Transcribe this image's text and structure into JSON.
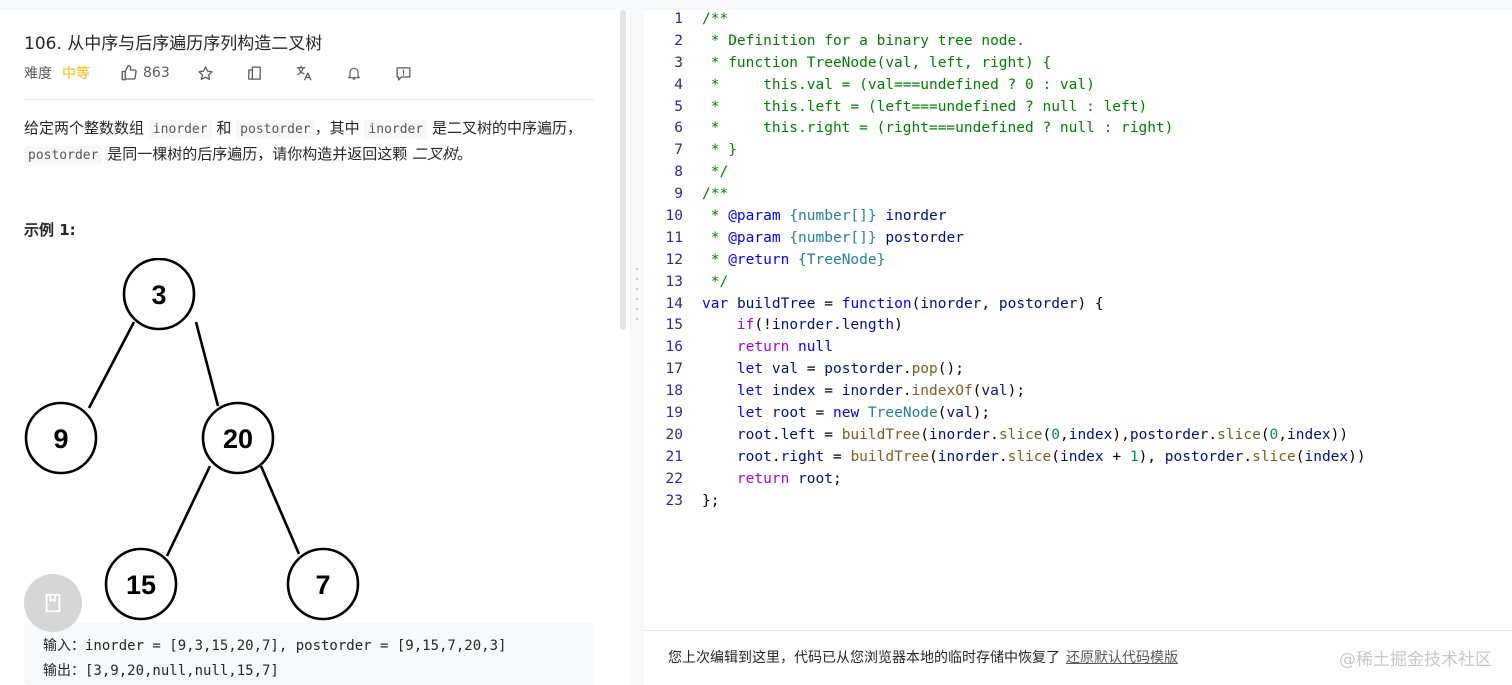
{
  "problem": {
    "title": "106. 从中序与后序遍历序列构造二叉树",
    "difficulty_label": "难度",
    "difficulty_value": "中等",
    "like_count": "863",
    "description": {
      "p1": "给定两个整数数组",
      "code1": "inorder",
      "p2": "和",
      "code2": "postorder",
      "p3": "，其中",
      "code3": "inorder",
      "p4": "是二叉树的中序遍历，",
      "code4": "postorder",
      "p5": "是同一棵树的后序遍历，请你构造并返回这颗",
      "p6": "二叉树",
      "p7": "。"
    },
    "example_title": "示例 1:",
    "tree_nodes": [
      "3",
      "9",
      "20",
      "15",
      "7"
    ],
    "example_input_label": "输入：",
    "example_input": "inorder = [9,3,15,20,7], postorder = [9,15,7,20,3]",
    "example_output_label": "输出：",
    "example_output": "[3,9,20,null,null,15,7]"
  },
  "icons": {
    "like": "thumbs-up-icon",
    "star": "star-icon",
    "share": "share-icon",
    "translate": "translate-icon",
    "notify": "bell-icon",
    "feedback": "feedback-icon",
    "note": "notebook-icon"
  },
  "colors": {
    "difficulty_medium": "#ffb800",
    "comment": "#008000",
    "keyword": "#0000ff",
    "control": "#af00db",
    "variable": "#001080",
    "function": "#795e26",
    "type": "#267f99",
    "number": "#098658",
    "line_number": "#2b2b8a"
  },
  "editor": {
    "lines": [
      {
        "n": "1",
        "tokens": [
          {
            "t": "/**",
            "c": "cm"
          }
        ]
      },
      {
        "n": "2",
        "tokens": [
          {
            "t": " * Definition for a binary tree node.",
            "c": "cm"
          }
        ]
      },
      {
        "n": "3",
        "tokens": [
          {
            "t": " * function TreeNode(val, left, right) {",
            "c": "cm"
          }
        ]
      },
      {
        "n": "4",
        "tokens": [
          {
            "t": " *     this.val = (val===undefined ? 0 : val)",
            "c": "cm"
          }
        ]
      },
      {
        "n": "5",
        "tokens": [
          {
            "t": " *     this.left = (left===undefined ? null : left)",
            "c": "cm"
          }
        ]
      },
      {
        "n": "6",
        "tokens": [
          {
            "t": " *     this.right = (right===undefined ? null : right)",
            "c": "cm"
          }
        ]
      },
      {
        "n": "7",
        "tokens": [
          {
            "t": " * }",
            "c": "cm"
          }
        ]
      },
      {
        "n": "8",
        "tokens": [
          {
            "t": " */",
            "c": "cm"
          }
        ]
      },
      {
        "n": "9",
        "tokens": [
          {
            "t": "/**",
            "c": "cm"
          }
        ]
      },
      {
        "n": "10",
        "tokens": [
          {
            "t": " * ",
            "c": "cm"
          },
          {
            "t": "@param",
            "c": "kw"
          },
          {
            "t": " ",
            "c": "cm"
          },
          {
            "t": "{number[]}",
            "c": "cls"
          },
          {
            "t": " ",
            "c": "cm"
          },
          {
            "t": "inorder",
            "c": "var"
          }
        ]
      },
      {
        "n": "11",
        "tokens": [
          {
            "t": " * ",
            "c": "cm"
          },
          {
            "t": "@param",
            "c": "kw"
          },
          {
            "t": " ",
            "c": "cm"
          },
          {
            "t": "{number[]}",
            "c": "cls"
          },
          {
            "t": " ",
            "c": "cm"
          },
          {
            "t": "postorder",
            "c": "var"
          }
        ]
      },
      {
        "n": "12",
        "tokens": [
          {
            "t": " * ",
            "c": "cm"
          },
          {
            "t": "@return",
            "c": "kw"
          },
          {
            "t": " ",
            "c": "cm"
          },
          {
            "t": "{TreeNode}",
            "c": "cls"
          }
        ]
      },
      {
        "n": "13",
        "tokens": [
          {
            "t": " */",
            "c": "cm"
          }
        ]
      },
      {
        "n": "14",
        "tokens": [
          {
            "t": "var",
            "c": "kw"
          },
          {
            "t": " ",
            "c": "pl"
          },
          {
            "t": "buildTree",
            "c": "var"
          },
          {
            "t": " = ",
            "c": "pl"
          },
          {
            "t": "function",
            "c": "kw"
          },
          {
            "t": "(",
            "c": "pl"
          },
          {
            "t": "inorder",
            "c": "var"
          },
          {
            "t": ", ",
            "c": "pl"
          },
          {
            "t": "postorder",
            "c": "var"
          },
          {
            "t": ") {",
            "c": "pl"
          }
        ]
      },
      {
        "n": "15",
        "tokens": [
          {
            "t": "    ",
            "c": "pl"
          },
          {
            "t": "if",
            "c": "ctl"
          },
          {
            "t": "(!",
            "c": "pl"
          },
          {
            "t": "inorder",
            "c": "var"
          },
          {
            "t": ".",
            "c": "pl"
          },
          {
            "t": "length",
            "c": "var"
          },
          {
            "t": ")",
            "c": "pl"
          }
        ]
      },
      {
        "n": "16",
        "tokens": [
          {
            "t": "    ",
            "c": "pl"
          },
          {
            "t": "return",
            "c": "ctl"
          },
          {
            "t": " ",
            "c": "pl"
          },
          {
            "t": "null",
            "c": "kw"
          }
        ]
      },
      {
        "n": "17",
        "tokens": [
          {
            "t": "    ",
            "c": "pl"
          },
          {
            "t": "let",
            "c": "kw"
          },
          {
            "t": " ",
            "c": "pl"
          },
          {
            "t": "val",
            "c": "var"
          },
          {
            "t": " = ",
            "c": "pl"
          },
          {
            "t": "postorder",
            "c": "var"
          },
          {
            "t": ".",
            "c": "pl"
          },
          {
            "t": "pop",
            "c": "fn"
          },
          {
            "t": "();",
            "c": "pl"
          }
        ]
      },
      {
        "n": "18",
        "tokens": [
          {
            "t": "    ",
            "c": "pl"
          },
          {
            "t": "let",
            "c": "kw"
          },
          {
            "t": " ",
            "c": "pl"
          },
          {
            "t": "index",
            "c": "var"
          },
          {
            "t": " = ",
            "c": "pl"
          },
          {
            "t": "inorder",
            "c": "var"
          },
          {
            "t": ".",
            "c": "pl"
          },
          {
            "t": "indexOf",
            "c": "fn"
          },
          {
            "t": "(",
            "c": "pl"
          },
          {
            "t": "val",
            "c": "var"
          },
          {
            "t": ");",
            "c": "pl"
          }
        ]
      },
      {
        "n": "19",
        "tokens": [
          {
            "t": "    ",
            "c": "pl"
          },
          {
            "t": "let",
            "c": "kw"
          },
          {
            "t": " ",
            "c": "pl"
          },
          {
            "t": "root",
            "c": "var"
          },
          {
            "t": " = ",
            "c": "pl"
          },
          {
            "t": "new",
            "c": "kw"
          },
          {
            "t": " ",
            "c": "pl"
          },
          {
            "t": "TreeNode",
            "c": "cls"
          },
          {
            "t": "(",
            "c": "pl"
          },
          {
            "t": "val",
            "c": "var"
          },
          {
            "t": ");",
            "c": "pl"
          }
        ]
      },
      {
        "n": "20",
        "tokens": [
          {
            "t": "    ",
            "c": "pl"
          },
          {
            "t": "root",
            "c": "var"
          },
          {
            "t": ".",
            "c": "pl"
          },
          {
            "t": "left",
            "c": "var"
          },
          {
            "t": " = ",
            "c": "pl"
          },
          {
            "t": "buildTree",
            "c": "fn"
          },
          {
            "t": "(",
            "c": "pl"
          },
          {
            "t": "inorder",
            "c": "var"
          },
          {
            "t": ".",
            "c": "pl"
          },
          {
            "t": "slice",
            "c": "fn"
          },
          {
            "t": "(",
            "c": "pl"
          },
          {
            "t": "0",
            "c": "num"
          },
          {
            "t": ",",
            "c": "pl"
          },
          {
            "t": "index",
            "c": "var"
          },
          {
            "t": "),",
            "c": "pl"
          },
          {
            "t": "postorder",
            "c": "var"
          },
          {
            "t": ".",
            "c": "pl"
          },
          {
            "t": "slice",
            "c": "fn"
          },
          {
            "t": "(",
            "c": "pl"
          },
          {
            "t": "0",
            "c": "num"
          },
          {
            "t": ",",
            "c": "pl"
          },
          {
            "t": "index",
            "c": "var"
          },
          {
            "t": "))",
            "c": "pl"
          }
        ]
      },
      {
        "n": "21",
        "tokens": [
          {
            "t": "    ",
            "c": "pl"
          },
          {
            "t": "root",
            "c": "var"
          },
          {
            "t": ".",
            "c": "pl"
          },
          {
            "t": "right",
            "c": "var"
          },
          {
            "t": " = ",
            "c": "pl"
          },
          {
            "t": "buildTree",
            "c": "fn"
          },
          {
            "t": "(",
            "c": "pl"
          },
          {
            "t": "inorder",
            "c": "var"
          },
          {
            "t": ".",
            "c": "pl"
          },
          {
            "t": "slice",
            "c": "fn"
          },
          {
            "t": "(",
            "c": "pl"
          },
          {
            "t": "index",
            "c": "var"
          },
          {
            "t": " + ",
            "c": "pl"
          },
          {
            "t": "1",
            "c": "num"
          },
          {
            "t": "), ",
            "c": "pl"
          },
          {
            "t": "postorder",
            "c": "var"
          },
          {
            "t": ".",
            "c": "pl"
          },
          {
            "t": "slice",
            "c": "fn"
          },
          {
            "t": "(",
            "c": "pl"
          },
          {
            "t": "index",
            "c": "var"
          },
          {
            "t": "))",
            "c": "pl"
          }
        ]
      },
      {
        "n": "22",
        "tokens": [
          {
            "t": "    ",
            "c": "pl"
          },
          {
            "t": "return",
            "c": "ctl"
          },
          {
            "t": " ",
            "c": "pl"
          },
          {
            "t": "root",
            "c": "var"
          },
          {
            "t": ";",
            "c": "pl"
          }
        ]
      },
      {
        "n": "23",
        "tokens": [
          {
            "t": "};",
            "c": "pl"
          }
        ]
      }
    ],
    "restore_notice": "您上次编辑到这里，代码已从您浏览器本地的临时存储中恢复了",
    "restore_link": "还原默认代码模版",
    "watermark": "@稀土掘金技术社区"
  }
}
